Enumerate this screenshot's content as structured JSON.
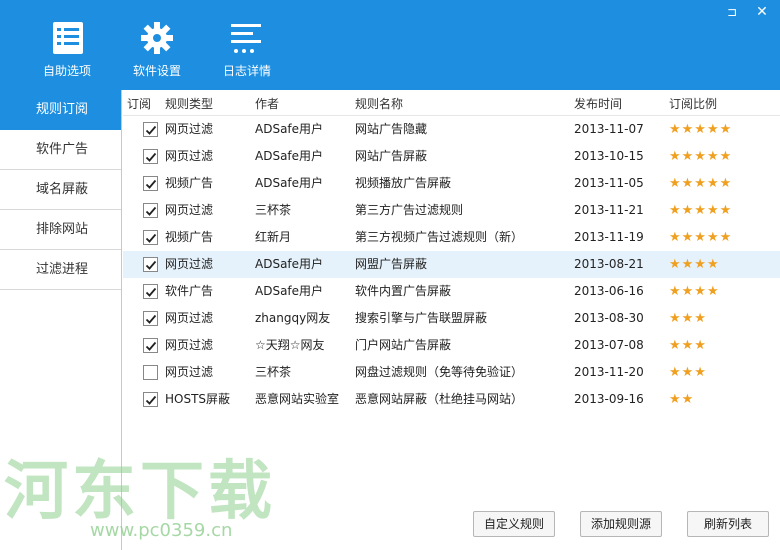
{
  "window": {
    "restore_glyph": "⊐",
    "close_glyph": "✕"
  },
  "toolbar": {
    "items": [
      {
        "label": "自助选项",
        "icon": "checklist-icon"
      },
      {
        "label": "软件设置",
        "icon": "gear-icon"
      },
      {
        "label": "日志详情",
        "icon": "log-lines-icon"
      }
    ]
  },
  "sidebar": {
    "items": [
      {
        "label": "规则订阅",
        "active": true
      },
      {
        "label": "软件广告",
        "active": false
      },
      {
        "label": "域名屏蔽",
        "active": false
      },
      {
        "label": "排除网站",
        "active": false
      },
      {
        "label": "过滤进程",
        "active": false
      }
    ]
  },
  "table": {
    "headers": {
      "subscribe": "订阅",
      "type": "规则类型",
      "author": "作者",
      "name": "规则名称",
      "date": "发布时间",
      "rating": "订阅比例"
    },
    "rows": [
      {
        "checked": true,
        "type": "网页过滤",
        "author": "ADSafe用户",
        "name": "网站广告隐藏",
        "date": "2013-11-07",
        "rating": "★★★★★"
      },
      {
        "checked": true,
        "type": "网页过滤",
        "author": "ADSafe用户",
        "name": "网站广告屏蔽",
        "date": "2013-10-15",
        "rating": "★★★★★"
      },
      {
        "checked": true,
        "type": "视频广告",
        "author": "ADSafe用户",
        "name": "视频播放广告屏蔽",
        "date": "2013-11-05",
        "rating": "★★★★★"
      },
      {
        "checked": true,
        "type": "网页过滤",
        "author": "三杯茶",
        "name": "第三方广告过滤规则",
        "date": "2013-11-21",
        "rating": "★★★★★"
      },
      {
        "checked": true,
        "type": "视频广告",
        "author": "红新月",
        "name": "第三方视频广告过滤规则（新）",
        "date": "2013-11-19",
        "rating": "★★★★★"
      },
      {
        "checked": true,
        "type": "网页过滤",
        "author": "ADSafe用户",
        "name": "网盟广告屏蔽",
        "date": "2013-08-21",
        "rating": "★★★★"
      },
      {
        "checked": true,
        "type": "软件广告",
        "author": "ADSafe用户",
        "name": "软件内置广告屏蔽",
        "date": "2013-06-16",
        "rating": "★★★★"
      },
      {
        "checked": true,
        "type": "网页过滤",
        "author": "zhangqy网友",
        "name": "搜索引擎与广告联盟屏蔽",
        "date": "2013-08-30",
        "rating": "★★★"
      },
      {
        "checked": true,
        "type": "网页过滤",
        "author": "☆天翔☆网友",
        "name": "门户网站广告屏蔽",
        "date": "2013-07-08",
        "rating": "★★★"
      },
      {
        "checked": false,
        "type": "网页过滤",
        "author": "三杯茶",
        "name": "网盘过滤规则（免等待免验证）",
        "date": "2013-11-20",
        "rating": "★★★"
      },
      {
        "checked": true,
        "type": "HOSTS屏蔽",
        "author": "恶意网站实验室",
        "name": "恶意网站屏蔽（杜绝挂马网站）",
        "date": "2013-09-16",
        "rating": "★★"
      }
    ]
  },
  "buttons": {
    "custom_rules": "自定义规则",
    "add_source": "添加规则源",
    "refresh_list": "刷新列表"
  },
  "watermark": {
    "text": "河东下载",
    "url": "www.pc0359.cn"
  },
  "colors": {
    "accent": "#1e8fe0",
    "star": "#f0a020",
    "selected_row": "#e6f2fb"
  }
}
